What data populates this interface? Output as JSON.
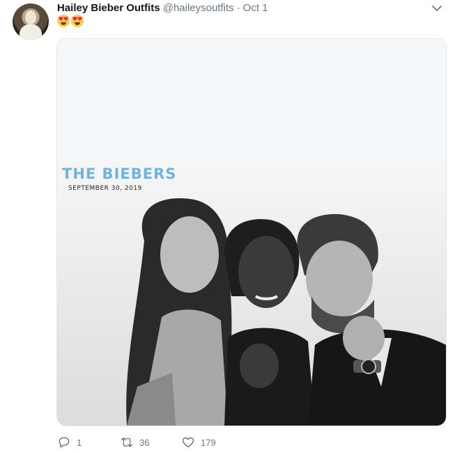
{
  "tweet": {
    "author_name": "Hailey Bieber Outfits",
    "author_handle": "@haileysoutfits",
    "separator": "·",
    "timestamp": "Oct 1",
    "emoji": [
      "heart-eyes-emoji",
      "heart-eyes-emoji"
    ]
  },
  "photo": {
    "caption_title": "THE BIEBERS",
    "caption_date": "SEPTEMBER 30, 2019"
  },
  "actions": {
    "reply_count": "1",
    "retweet_count": "36",
    "like_count": "179"
  },
  "colors": {
    "text_primary": "#14171a",
    "text_secondary": "#657786",
    "border": "#e1e8ed",
    "caption_blue": "#6fb3df"
  }
}
